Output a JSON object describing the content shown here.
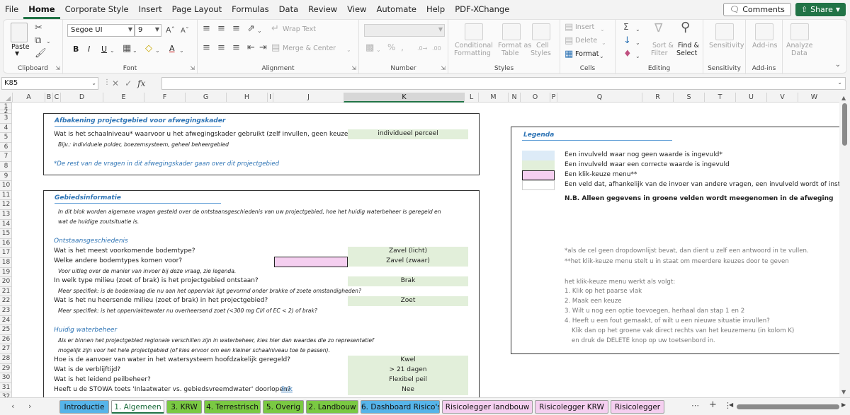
{
  "menu": {
    "items": [
      "File",
      "Home",
      "Corporate Style",
      "Insert",
      "Page Layout",
      "Formulas",
      "Data",
      "Review",
      "View",
      "Automate",
      "Help",
      "PDF-XChange"
    ],
    "active": "Home",
    "comments_label": "Comments",
    "share_label": "Share"
  },
  "ribbon": {
    "clipboard": {
      "label": "Clipboard",
      "paste": "Paste"
    },
    "font": {
      "label": "Font",
      "font_name": "Segoe UI",
      "font_size": "9",
      "bold": "B",
      "italic": "I",
      "underline": "U"
    },
    "alignment": {
      "label": "Alignment",
      "wrap_text": "Wrap Text",
      "merge_center": "Merge & Center"
    },
    "number": {
      "label": "Number",
      "format": ""
    },
    "styles": {
      "label": "Styles",
      "conditional": [
        "Conditional",
        "Formatting"
      ],
      "format_as_table": [
        "Format as",
        "Table"
      ],
      "cell_styles": [
        "Cell",
        "Styles"
      ]
    },
    "cells": {
      "label": "Cells",
      "insert": "Insert",
      "delete": "Delete",
      "format": "Format"
    },
    "editing": {
      "label": "Editing",
      "sort_filter": [
        "Sort &",
        "Filter"
      ],
      "find_select": [
        "Find &",
        "Select"
      ]
    },
    "sensitivity": {
      "label": "Sensitivity",
      "button": "Sensitivity"
    },
    "addins": {
      "label": "Add-ins",
      "button": "Add-ins"
    },
    "analyze": {
      "button": [
        "Analyze",
        "Data"
      ]
    }
  },
  "formula_bar": {
    "name_box": "K85",
    "formula": "",
    "fx": "fx"
  },
  "columns": [
    "A",
    "B",
    "C",
    "D",
    "E",
    "F",
    "G",
    "H",
    "I",
    "J",
    "K",
    "L",
    "M",
    "N",
    "O",
    "P",
    "Q",
    "R",
    "S",
    "T",
    "U",
    "V",
    "W"
  ],
  "selected_column": "K",
  "rows": [
    "1",
    "2",
    "3",
    "4",
    "5",
    "6",
    "7",
    "8",
    "9",
    "10",
    "11",
    "12",
    "13",
    "14",
    "15",
    "16",
    "17",
    "18",
    "19",
    "20",
    "21",
    "22",
    "23",
    "24",
    "25",
    "26",
    "27",
    "28",
    "29",
    "30",
    "31",
    "32"
  ],
  "sheet": {
    "afbakening": {
      "title": "Afbakening projectgebied voor afwegingskader",
      "question": "Wat is het schaalniveau* waarvoor u het afwegingskader gebruikt (zelf invullen, geen keuzemenu)?",
      "answer": "individueel perceel",
      "example": "Bijv.: individuele polder, boezemsysteem, geheel beheergebied",
      "note": "*De rest van de vragen in dit afwegingskader gaan over dit projectgebied"
    },
    "gebiedsinformatie": {
      "title": "Gebiedsinformatie",
      "intro1": "In dit blok worden algemene vragen gesteld over de ontstaansgeschiedenis van uw projectgebied, hoe het huidig waterbeheer is geregeld en",
      "intro2": "wat de huidige zoutsituatie is.",
      "sub1": "Ontstaansgeschiedenis",
      "q1": "Wat is het meest voorkomende bodemtype?",
      "a1": "Zavel (licht)",
      "q2": "Welke andere bodemtypes komen voor?",
      "a2": "Zavel (zwaar)",
      "h2": "Voor uitleg over de manier van invoer bij deze vraag, zie legenda.",
      "q3": "In welk type milieu (zoet of brak) is het projectgebied ontstaan?",
      "a3": "Brak",
      "h3": "Meer specifiek: is de bodemlaag die nu aan het oppervlak ligt gevormd onder brakke of zoete omstandigheden?",
      "q4": "Wat is het nu heersende milieu (zoet of brak) in het projectgebied?",
      "a4": "Zoet",
      "h4": "Meer specifiek: is het oppervlaktewater nu overheersend zoet (<300 mg Cl/l of EC < 2) of brak?",
      "sub2": "Huidig waterbeheer",
      "intro3": "Als er binnen het projectgebied regionale verschillen zijn in waterbeheer, kies hier dan waardes die zo representatief",
      "intro4": "mogelijk zijn voor het hele projectgebied (of kies ervoor om een kleiner schaalniveau toe te passen).",
      "q5": "Hoe is de aanvoer van water in het watersysteem hoofdzakelijk geregeld?",
      "a5": "Kwel",
      "q6": "Wat is de verblijftijd?",
      "a6": "> 21 dagen",
      "q7": "Wat is het leidend peilbeheer?",
      "a7": "Flexibel peil",
      "q8": "Heeft u de STOWA toets 'Inlaatwater vs. gebiedsvreemdwater' doorlopen?",
      "q8_link": "link",
      "a8": "Nee"
    },
    "legenda": {
      "title": "Legenda",
      "items": [
        "Een invulveld waar nog geen waarde is ingevuld*",
        "Een invulveld waar een correcte waarde is ingevuld",
        "Een klik-keuze menu**",
        "Een veld dat, afhankelijk van de invoer van andere vragen, een invulveld wordt of instructies geeft"
      ],
      "swatch_colors": [
        "#ddebf7",
        "#e2efda",
        "#f5cff0",
        "#ffffff"
      ],
      "nb": "N.B. Alleen gegevens in groene velden wordt meegenomen in de afweging",
      "foot1": "*als de cel geen dropdownlijst bevat, dan dient u zelf een antwoord in te vullen.",
      "foot2": "**het klik-keuze menu stelt u in staat om meerdere keuzes door te geven",
      "howto": "het klik-keuze menu werkt als volgt:",
      "steps": [
        "1. Klik op het paarse vlak",
        "2. Maak een keuze",
        "3. Wilt u nog een optie toevoegen, herhaal dan stap 1 en 2",
        "4. Heeft u een fout gemaakt, of wilt u een nieuwe situatie invullen?",
        "    Klik dan op het groene vak direct rechts van het keuzemenu (in kolom K)",
        "    en druk de DELETE knop op uw toetsenbord in."
      ]
    }
  },
  "tabs": [
    {
      "label": "Introductie",
      "color": "#56b4e9",
      "active": false
    },
    {
      "label": "1. Algemeen",
      "color": "#ffffff",
      "active": true
    },
    {
      "label": "3. KRW",
      "color": "#7ac943",
      "active": false
    },
    {
      "label": "4. Terrestrisch",
      "color": "#7ac943",
      "active": false
    },
    {
      "label": "5. Overig",
      "color": "#7ac943",
      "active": false
    },
    {
      "label": "2. Landbouw",
      "color": "#7ac943",
      "active": false
    },
    {
      "label": "6. Dashboard Risico's",
      "color": "#56b4e9",
      "active": false
    },
    {
      "label": "Risicolegger landbouw",
      "color": "#f5cff0",
      "active": false
    },
    {
      "label": "Risicolegger KRW",
      "color": "#f5cff0",
      "active": false
    },
    {
      "label": "Risicolegger",
      "color": "#f5cff0",
      "active": false
    }
  ]
}
